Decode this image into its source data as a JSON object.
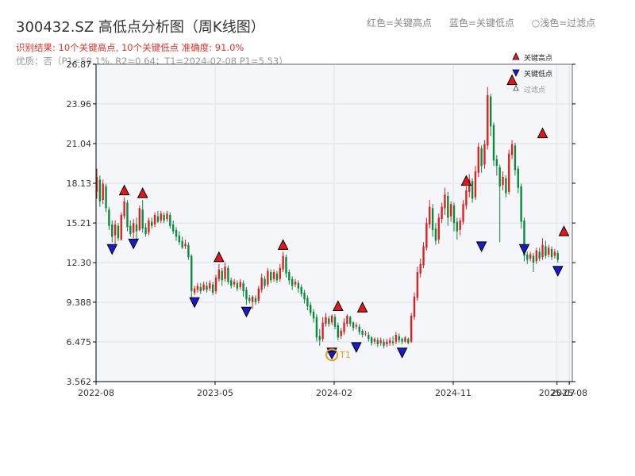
{
  "header": {
    "title": "300432.SZ 高低点分析图（周K线图）",
    "legend_red": "红色=关键高点",
    "legend_blue": "蓝色=关键低点",
    "legend_light": "○浅色=过滤点",
    "result_text": "识别结果: 10个关键高点, 10个关键低点   准确度: 91.0%",
    "quality_text": "优质：否（P1=58.1%, R2=0.64；T1=2024-02-08 P1=5.53）"
  },
  "colors": {
    "up": "#e02020",
    "down": "#0a8a3a",
    "high_marker": "#e8141c",
    "low_marker": "#1a1acc",
    "t1_marker": "#f29a1a",
    "plot_bg": "#f4f6f9",
    "grid": "#dde2ea"
  },
  "chart_data": {
    "type": "candlestick",
    "title": "300432.SZ 高低点分析图（周K线图）",
    "y_ticks": [
      "3.562",
      "6.475",
      "9.388",
      "12.30",
      "15.21",
      "18.13",
      "21.04",
      "23.96",
      "26.87"
    ],
    "ylim": [
      3.562,
      26.87
    ],
    "x_ticks": [
      {
        "label": "2022-08",
        "week": 0
      },
      {
        "label": "2023-05",
        "week": 39
      },
      {
        "label": "2024-02",
        "week": 78
      },
      {
        "label": "2024-11",
        "week": 117
      },
      {
        "label": "2025-07",
        "week": 151
      },
      {
        "label": "2025-08",
        "week": 155
      }
    ],
    "x_range_weeks": [
      0,
      156
    ],
    "grid": true,
    "legend": {
      "position": "top-right",
      "entries": [
        "关键高点",
        "关键低点",
        "过滤点"
      ]
    },
    "candles": [
      {
        "o": 17.5,
        "c": 18.6,
        "h": 19.2,
        "l": 17.0
      },
      {
        "o": 18.4,
        "c": 16.8,
        "h": 18.7,
        "l": 16.4
      },
      {
        "o": 16.9,
        "c": 18.1,
        "h": 18.4,
        "l": 16.6
      },
      {
        "o": 17.9,
        "c": 16.3,
        "h": 18.1,
        "l": 16.0
      },
      {
        "o": 16.2,
        "c": 15.0,
        "h": 16.4,
        "l": 14.7
      },
      {
        "o": 15.1,
        "c": 14.2,
        "h": 15.4,
        "l": 13.8
      },
      {
        "o": 14.3,
        "c": 15.1,
        "h": 15.4,
        "l": 13.5
      },
      {
        "o": 15.0,
        "c": 14.1,
        "h": 15.2,
        "l": 13.9
      },
      {
        "o": 14.0,
        "c": 15.8,
        "h": 16.0,
        "l": 13.9
      },
      {
        "o": 15.7,
        "c": 16.8,
        "h": 17.1,
        "l": 15.5
      },
      {
        "o": 16.7,
        "c": 14.9,
        "h": 16.9,
        "l": 14.6
      },
      {
        "o": 15.0,
        "c": 14.4,
        "h": 15.4,
        "l": 14.2
      },
      {
        "o": 14.5,
        "c": 15.2,
        "h": 15.5,
        "l": 14.1
      },
      {
        "o": 15.1,
        "c": 14.6,
        "h": 15.6,
        "l": 14.0
      },
      {
        "o": 14.7,
        "c": 16.3,
        "h": 16.5,
        "l": 14.6
      },
      {
        "o": 16.2,
        "c": 14.8,
        "h": 16.9,
        "l": 14.5
      },
      {
        "o": 14.9,
        "c": 14.4,
        "h": 15.2,
        "l": 14.2
      },
      {
        "o": 14.5,
        "c": 15.4,
        "h": 15.6,
        "l": 14.3
      },
      {
        "o": 15.3,
        "c": 15.0,
        "h": 15.6,
        "l": 14.8
      },
      {
        "o": 15.1,
        "c": 15.8,
        "h": 16.0,
        "l": 14.9
      },
      {
        "o": 15.7,
        "c": 15.3,
        "h": 16.1,
        "l": 15.2
      },
      {
        "o": 15.4,
        "c": 15.9,
        "h": 16.1,
        "l": 15.2
      },
      {
        "o": 15.8,
        "c": 15.4,
        "h": 16.0,
        "l": 15.2
      },
      {
        "o": 15.5,
        "c": 15.9,
        "h": 16.1,
        "l": 15.3
      },
      {
        "o": 15.8,
        "c": 15.0,
        "h": 16.0,
        "l": 14.8
      },
      {
        "o": 15.1,
        "c": 14.6,
        "h": 15.4,
        "l": 14.4
      },
      {
        "o": 14.7,
        "c": 14.2,
        "h": 14.9,
        "l": 13.9
      },
      {
        "o": 14.3,
        "c": 13.8,
        "h": 14.6,
        "l": 13.6
      },
      {
        "o": 13.9,
        "c": 13.4,
        "h": 14.2,
        "l": 13.3
      },
      {
        "o": 13.5,
        "c": 13.7,
        "h": 14.0,
        "l": 13.3
      },
      {
        "o": 13.6,
        "c": 12.7,
        "h": 13.8,
        "l": 12.5
      },
      {
        "o": 12.8,
        "c": 10.2,
        "h": 12.9,
        "l": 9.6
      },
      {
        "o": 10.1,
        "c": 10.4,
        "h": 10.6,
        "l": 9.9
      },
      {
        "o": 10.3,
        "c": 10.6,
        "h": 10.8,
        "l": 10.1
      },
      {
        "o": 10.5,
        "c": 10.2,
        "h": 10.8,
        "l": 10.0
      },
      {
        "o": 10.3,
        "c": 10.7,
        "h": 10.9,
        "l": 10.2
      },
      {
        "o": 10.6,
        "c": 10.3,
        "h": 10.9,
        "l": 10.1
      },
      {
        "o": 10.4,
        "c": 10.8,
        "h": 11.0,
        "l": 10.2
      },
      {
        "o": 10.7,
        "c": 10.1,
        "h": 10.9,
        "l": 9.9
      },
      {
        "o": 10.2,
        "c": 11.2,
        "h": 11.4,
        "l": 10.0
      },
      {
        "o": 11.1,
        "c": 11.8,
        "h": 12.2,
        "l": 10.9
      },
      {
        "o": 11.7,
        "c": 11.0,
        "h": 11.9,
        "l": 10.6
      },
      {
        "o": 11.1,
        "c": 12.0,
        "h": 12.3,
        "l": 10.9
      },
      {
        "o": 11.9,
        "c": 10.9,
        "h": 12.1,
        "l": 10.7
      },
      {
        "o": 11.0,
        "c": 10.6,
        "h": 11.2,
        "l": 10.4
      },
      {
        "o": 10.7,
        "c": 10.9,
        "h": 11.1,
        "l": 10.5
      },
      {
        "o": 10.8,
        "c": 10.4,
        "h": 11.0,
        "l": 10.2
      },
      {
        "o": 10.5,
        "c": 10.9,
        "h": 11.1,
        "l": 10.3
      },
      {
        "o": 10.8,
        "c": 10.2,
        "h": 11.0,
        "l": 9.8
      },
      {
        "o": 10.3,
        "c": 9.6,
        "h": 10.5,
        "l": 9.2
      },
      {
        "o": 9.7,
        "c": 9.5,
        "h": 9.9,
        "l": 9.3
      },
      {
        "o": 9.4,
        "c": 9.8,
        "h": 9.9,
        "l": 8.9
      },
      {
        "o": 9.7,
        "c": 9.4,
        "h": 9.9,
        "l": 9.2
      },
      {
        "o": 9.5,
        "c": 10.4,
        "h": 10.6,
        "l": 9.3
      },
      {
        "o": 10.3,
        "c": 11.2,
        "h": 11.5,
        "l": 10.1
      },
      {
        "o": 11.1,
        "c": 10.6,
        "h": 11.3,
        "l": 10.4
      },
      {
        "o": 10.7,
        "c": 11.7,
        "h": 11.9,
        "l": 10.5
      },
      {
        "o": 11.6,
        "c": 11.0,
        "h": 11.8,
        "l": 10.8
      },
      {
        "o": 11.1,
        "c": 11.6,
        "h": 11.8,
        "l": 10.9
      },
      {
        "o": 11.5,
        "c": 11.0,
        "h": 11.7,
        "l": 10.8
      },
      {
        "o": 11.1,
        "c": 11.9,
        "h": 12.2,
        "l": 10.9
      },
      {
        "o": 11.8,
        "c": 12.8,
        "h": 13.1,
        "l": 11.6
      },
      {
        "o": 12.7,
        "c": 11.5,
        "h": 12.9,
        "l": 11.2
      },
      {
        "o": 11.6,
        "c": 11.0,
        "h": 11.8,
        "l": 10.7
      },
      {
        "o": 11.1,
        "c": 10.6,
        "h": 11.3,
        "l": 10.3
      },
      {
        "o": 10.7,
        "c": 10.9,
        "h": 11.1,
        "l": 10.5
      },
      {
        "o": 10.8,
        "c": 10.4,
        "h": 11.0,
        "l": 10.1
      },
      {
        "o": 10.5,
        "c": 10.0,
        "h": 10.7,
        "l": 9.8
      },
      {
        "o": 10.1,
        "c": 9.6,
        "h": 10.3,
        "l": 9.3
      },
      {
        "o": 9.7,
        "c": 9.1,
        "h": 9.9,
        "l": 8.8
      },
      {
        "o": 9.2,
        "c": 8.6,
        "h": 9.4,
        "l": 8.4
      },
      {
        "o": 8.7,
        "c": 8.2,
        "h": 8.9,
        "l": 7.9
      },
      {
        "o": 8.3,
        "c": 6.8,
        "h": 8.5,
        "l": 6.5
      },
      {
        "o": 6.9,
        "c": 6.6,
        "h": 7.4,
        "l": 6.2
      },
      {
        "o": 6.7,
        "c": 7.9,
        "h": 8.3,
        "l": 6.5
      },
      {
        "o": 7.8,
        "c": 8.3,
        "h": 8.6,
        "l": 7.6
      },
      {
        "o": 8.2,
        "c": 7.8,
        "h": 8.4,
        "l": 7.6
      },
      {
        "o": 7.9,
        "c": 8.4,
        "h": 8.5,
        "l": 7.7
      },
      {
        "o": 8.3,
        "c": 7.6,
        "h": 8.5,
        "l": 7.4
      },
      {
        "o": 7.7,
        "c": 6.8,
        "h": 7.9,
        "l": 6.6
      },
      {
        "o": 6.9,
        "c": 7.3,
        "h": 7.5,
        "l": 6.7
      },
      {
        "o": 7.2,
        "c": 7.9,
        "h": 8.2,
        "l": 7.0
      },
      {
        "o": 7.8,
        "c": 8.4,
        "h": 8.5,
        "l": 7.6
      },
      {
        "o": 8.3,
        "c": 7.8,
        "h": 8.4,
        "l": 7.6
      },
      {
        "o": 7.9,
        "c": 7.5,
        "h": 8.0,
        "l": 7.3
      },
      {
        "o": 7.6,
        "c": 7.7,
        "h": 7.9,
        "l": 7.4
      },
      {
        "o": 7.6,
        "c": 7.2,
        "h": 7.8,
        "l": 7.0
      },
      {
        "o": 7.3,
        "c": 7.0,
        "h": 7.4,
        "l": 6.8
      },
      {
        "o": 7.1,
        "c": 7.1,
        "h": 7.3,
        "l": 6.9
      },
      {
        "o": 7.0,
        "c": 6.7,
        "h": 7.2,
        "l": 6.5
      },
      {
        "o": 6.8,
        "c": 6.4,
        "h": 6.9,
        "l": 6.2
      },
      {
        "o": 6.5,
        "c": 6.7,
        "h": 6.8,
        "l": 6.3
      },
      {
        "o": 6.6,
        "c": 6.3,
        "h": 6.8,
        "l": 6.1
      },
      {
        "o": 6.4,
        "c": 6.6,
        "h": 6.8,
        "l": 6.2
      },
      {
        "o": 6.5,
        "c": 6.2,
        "h": 6.7,
        "l": 6.0
      },
      {
        "o": 6.3,
        "c": 6.5,
        "h": 6.7,
        "l": 6.1
      },
      {
        "o": 6.4,
        "c": 6.6,
        "h": 6.8,
        "l": 6.2
      },
      {
        "o": 6.5,
        "c": 6.4,
        "h": 6.9,
        "l": 6.2
      },
      {
        "o": 6.5,
        "c": 7.0,
        "h": 7.2,
        "l": 6.3
      },
      {
        "o": 6.9,
        "c": 6.6,
        "h": 7.1,
        "l": 6.4
      },
      {
        "o": 6.7,
        "c": 6.5,
        "h": 6.8,
        "l": 6.3
      },
      {
        "o": 6.5,
        "c": 6.8,
        "h": 6.9,
        "l": 6.4
      },
      {
        "o": 6.7,
        "c": 6.4,
        "h": 6.8,
        "l": 6.3
      },
      {
        "o": 6.5,
        "c": 8.4,
        "h": 8.6,
        "l": 6.4
      },
      {
        "o": 8.3,
        "c": 9.8,
        "h": 10.1,
        "l": 8.1
      },
      {
        "o": 9.7,
        "c": 11.6,
        "h": 12.0,
        "l": 9.5
      },
      {
        "o": 11.5,
        "c": 12.2,
        "h": 12.6,
        "l": 11.2
      },
      {
        "o": 12.1,
        "c": 13.5,
        "h": 13.8,
        "l": 11.9
      },
      {
        "o": 13.4,
        "c": 15.2,
        "h": 15.6,
        "l": 13.2
      },
      {
        "o": 15.1,
        "c": 16.4,
        "h": 16.9,
        "l": 14.8
      },
      {
        "o": 16.3,
        "c": 14.7,
        "h": 16.6,
        "l": 14.2
      },
      {
        "o": 14.8,
        "c": 13.9,
        "h": 15.2,
        "l": 13.6
      },
      {
        "o": 14.0,
        "c": 15.6,
        "h": 15.9,
        "l": 13.7
      },
      {
        "o": 15.5,
        "c": 16.4,
        "h": 16.7,
        "l": 15.2
      },
      {
        "o": 16.3,
        "c": 17.3,
        "h": 17.8,
        "l": 15.8
      },
      {
        "o": 17.2,
        "c": 15.6,
        "h": 17.5,
        "l": 15.0
      },
      {
        "o": 15.7,
        "c": 16.6,
        "h": 16.8,
        "l": 15.3
      },
      {
        "o": 16.5,
        "c": 15.2,
        "h": 16.7,
        "l": 14.6
      },
      {
        "o": 15.3,
        "c": 14.6,
        "h": 15.6,
        "l": 14.0
      },
      {
        "o": 14.7,
        "c": 15.4,
        "h": 15.6,
        "l": 14.3
      },
      {
        "o": 15.3,
        "c": 16.6,
        "h": 16.9,
        "l": 15.1
      },
      {
        "o": 16.5,
        "c": 17.6,
        "h": 17.9,
        "l": 16.2
      },
      {
        "o": 17.5,
        "c": 18.4,
        "h": 18.8,
        "l": 17.1
      },
      {
        "o": 18.3,
        "c": 17.0,
        "h": 18.5,
        "l": 16.7
      },
      {
        "o": 17.1,
        "c": 19.0,
        "h": 19.4,
        "l": 16.9
      },
      {
        "o": 18.9,
        "c": 20.8,
        "h": 21.1,
        "l": 18.6
      },
      {
        "o": 20.7,
        "c": 19.4,
        "h": 20.9,
        "l": 18.9
      },
      {
        "o": 19.5,
        "c": 21.0,
        "h": 21.3,
        "l": 19.2
      },
      {
        "o": 20.9,
        "c": 24.6,
        "h": 25.2,
        "l": 20.6
      },
      {
        "o": 24.5,
        "c": 22.3,
        "h": 24.7,
        "l": 21.6
      },
      {
        "o": 22.4,
        "c": 19.8,
        "h": 22.6,
        "l": 19.4
      },
      {
        "o": 19.9,
        "c": 19.4,
        "h": 20.2,
        "l": 18.7
      },
      {
        "o": 19.3,
        "c": 17.9,
        "h": 19.5,
        "l": 13.8
      },
      {
        "o": 18.0,
        "c": 18.6,
        "h": 19.0,
        "l": 17.6
      },
      {
        "o": 18.5,
        "c": 17.4,
        "h": 18.7,
        "l": 17.1
      },
      {
        "o": 17.5,
        "c": 20.3,
        "h": 20.6,
        "l": 17.3
      },
      {
        "o": 20.2,
        "c": 21.0,
        "h": 21.3,
        "l": 19.9
      },
      {
        "o": 20.9,
        "c": 19.1,
        "h": 21.1,
        "l": 18.7
      },
      {
        "o": 19.2,
        "c": 17.8,
        "h": 19.4,
        "l": 17.4
      },
      {
        "o": 17.9,
        "c": 15.3,
        "h": 18.1,
        "l": 14.8
      },
      {
        "o": 15.4,
        "c": 12.8,
        "h": 15.6,
        "l": 12.4
      },
      {
        "o": 12.9,
        "c": 12.5,
        "h": 13.1,
        "l": 12.2
      },
      {
        "o": 12.6,
        "c": 12.9,
        "h": 13.1,
        "l": 12.4
      },
      {
        "o": 12.8,
        "c": 12.3,
        "h": 13.0,
        "l": 11.6
      },
      {
        "o": 12.4,
        "c": 13.2,
        "h": 13.4,
        "l": 12.2
      },
      {
        "o": 13.1,
        "c": 12.6,
        "h": 13.4,
        "l": 12.4
      },
      {
        "o": 12.7,
        "c": 13.6,
        "h": 14.1,
        "l": 12.5
      },
      {
        "o": 13.5,
        "c": 12.8,
        "h": 13.9,
        "l": 12.6
      },
      {
        "o": 12.9,
        "c": 13.4,
        "h": 13.6,
        "l": 12.7
      },
      {
        "o": 13.3,
        "c": 12.7,
        "h": 13.5,
        "l": 12.5
      },
      {
        "o": 12.8,
        "c": 13.1,
        "h": 13.3,
        "l": 12.6
      },
      {
        "o": 13.0,
        "c": 12.5,
        "h": 13.2,
        "l": 12.3
      }
    ],
    "key_highs": [
      {
        "week": 9,
        "price": 17.1
      },
      {
        "week": 15,
        "price": 16.9
      },
      {
        "week": 40,
        "price": 12.2
      },
      {
        "week": 61,
        "price": 13.1
      },
      {
        "week": 79,
        "price": 8.6
      },
      {
        "week": 87,
        "price": 8.5
      },
      {
        "week": 121,
        "price": 17.8
      },
      {
        "week": 136,
        "price": 25.2
      },
      {
        "week": 146,
        "price": 21.3
      },
      {
        "week": 153,
        "price": 14.1
      }
    ],
    "key_lows": [
      {
        "week": 5,
        "price": 13.8
      },
      {
        "week": 12,
        "price": 14.2
      },
      {
        "week": 32,
        "price": 9.9
      },
      {
        "week": 49,
        "price": 9.2
      },
      {
        "week": 77,
        "price": 6.2
      },
      {
        "week": 85,
        "price": 6.6
      },
      {
        "week": 100,
        "price": 6.2
      },
      {
        "week": 126,
        "price": 14.0
      },
      {
        "week": 140,
        "price": 13.8
      },
      {
        "week": 151,
        "price": 12.2
      }
    ],
    "t1": {
      "label": "T1",
      "week": 77,
      "price": 5.53
    }
  }
}
